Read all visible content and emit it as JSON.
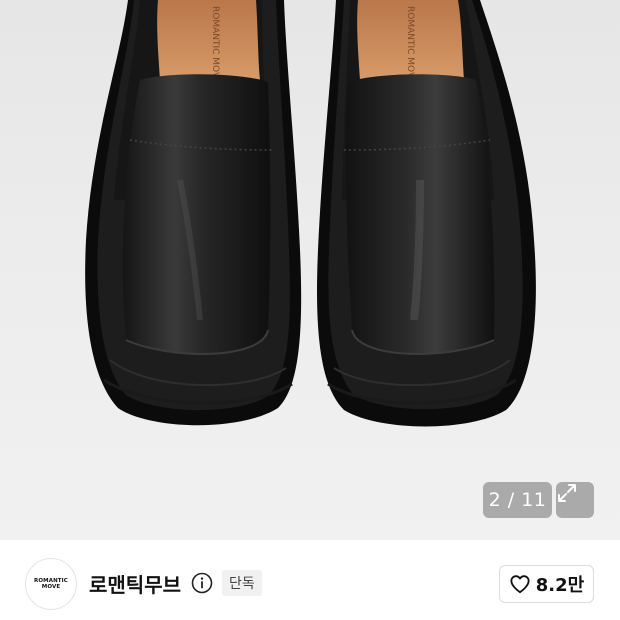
{
  "gallery": {
    "current": 2,
    "total": 11,
    "counter_text": "2 / 11",
    "insole_print": "ROMANTIC MOVE",
    "expand_icon": "expand-arrows-icon"
  },
  "brand": {
    "logo_line1": "ROMANTIC",
    "logo_line2": "MOVE",
    "name": "로맨틱무브",
    "info_icon": "info-icon",
    "badge": "단독"
  },
  "like": {
    "icon": "heart-outline-icon",
    "count": "8.2만"
  },
  "colors": {
    "background": "#ffffff",
    "photo_background": "#ececec",
    "overlay": "#969696",
    "text": "#111111",
    "badge_bg": "#f1f1f1"
  }
}
